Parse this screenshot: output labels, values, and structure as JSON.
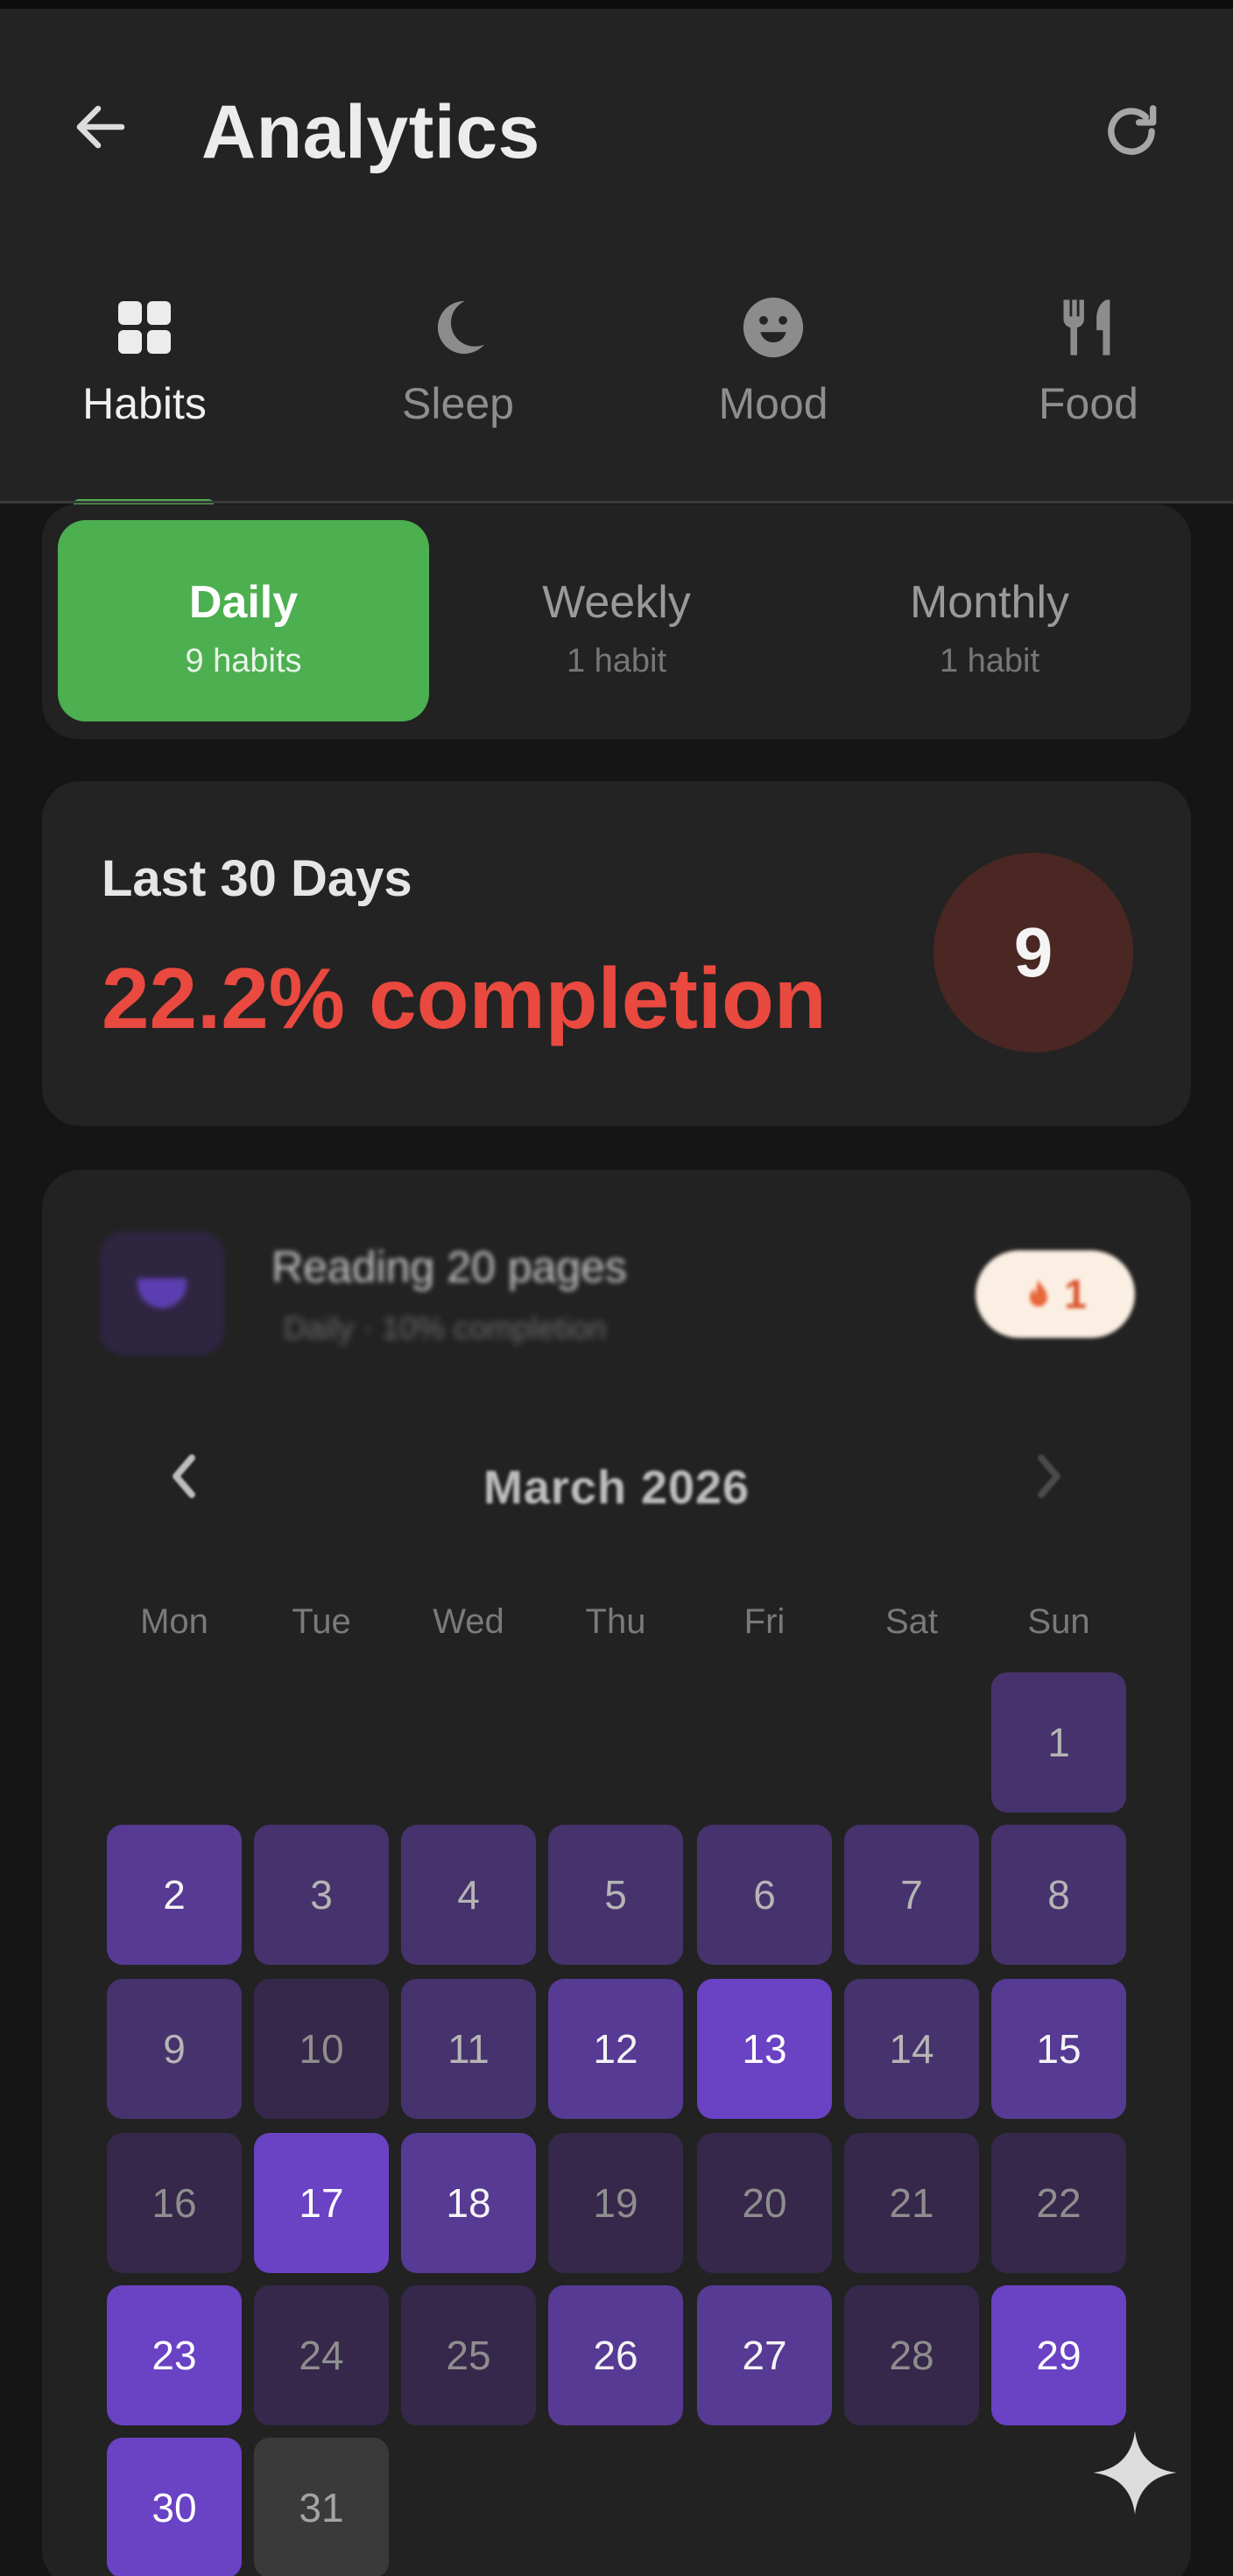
{
  "header": {
    "title": "Analytics",
    "back_icon": "arrow-left-icon",
    "refresh_icon": "refresh-icon"
  },
  "tabs": [
    {
      "label": "Habits",
      "icon": "grid-icon",
      "active": true
    },
    {
      "label": "Sleep",
      "icon": "moon-icon",
      "active": false
    },
    {
      "label": "Mood",
      "icon": "smiley-icon",
      "active": false
    },
    {
      "label": "Food",
      "icon": "fork-knife-icon",
      "active": false
    }
  ],
  "frequency": [
    {
      "label": "Daily",
      "count": "9 habits",
      "active": true
    },
    {
      "label": "Weekly",
      "count": "1 habit",
      "active": false
    },
    {
      "label": "Monthly",
      "count": "1 habit",
      "active": false
    }
  ],
  "stats": {
    "period": "Last 30 Days",
    "completion": "22.2% completion",
    "habit_count": "9"
  },
  "habit": {
    "name": "Reading 20 pages",
    "subtitle": "Daily · 10% completion",
    "streak": "1"
  },
  "calendar": {
    "month": "March 2026",
    "weekdays": [
      "Mon",
      "Tue",
      "Wed",
      "Thu",
      "Fri",
      "Sat",
      "Sun"
    ],
    "first_weekday_index": 6,
    "days": [
      {
        "d": "1",
        "level": 2
      },
      {
        "d": "2",
        "level": 3
      },
      {
        "d": "3",
        "level": 2
      },
      {
        "d": "4",
        "level": 2
      },
      {
        "d": "5",
        "level": 2
      },
      {
        "d": "6",
        "level": 2
      },
      {
        "d": "7",
        "level": 2
      },
      {
        "d": "8",
        "level": 2
      },
      {
        "d": "9",
        "level": 2
      },
      {
        "d": "10",
        "level": 1
      },
      {
        "d": "11",
        "level": 2
      },
      {
        "d": "12",
        "level": 3
      },
      {
        "d": "13",
        "level": 4
      },
      {
        "d": "14",
        "level": 2
      },
      {
        "d": "15",
        "level": 3
      },
      {
        "d": "16",
        "level": 1
      },
      {
        "d": "17",
        "level": 4
      },
      {
        "d": "18",
        "level": 3
      },
      {
        "d": "19",
        "level": 1
      },
      {
        "d": "20",
        "level": 1
      },
      {
        "d": "21",
        "level": 1
      },
      {
        "d": "22",
        "level": 1
      },
      {
        "d": "23",
        "level": 4
      },
      {
        "d": "24",
        "level": 1
      },
      {
        "d": "25",
        "level": 1
      },
      {
        "d": "26",
        "level": 3
      },
      {
        "d": "27",
        "level": 3
      },
      {
        "d": "28",
        "level": 1
      },
      {
        "d": "29",
        "level": 4
      },
      {
        "d": "30",
        "level": 4
      },
      {
        "d": "31",
        "level": 0
      }
    ],
    "level_colors": [
      "#3a3a3a",
      "#35284a",
      "#46326c",
      "#573a94",
      "#6a42c4"
    ]
  },
  "accent": "#4caf50",
  "completion_color": "#e9493f"
}
